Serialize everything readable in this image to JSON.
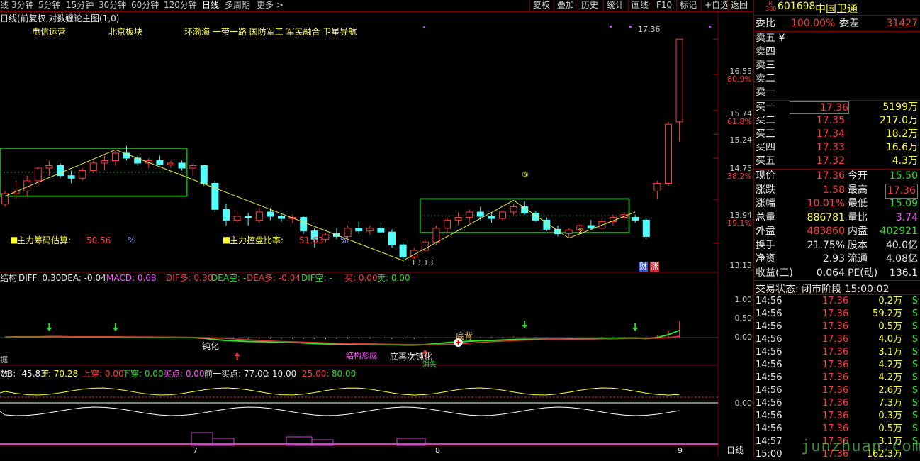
{
  "toolbar": {
    "periods": [
      "线",
      "3分钟",
      "5分钟",
      "15分钟",
      "30分钟",
      "60分钟",
      "120分钟",
      "日线",
      "多周期",
      "更多 >"
    ],
    "buttons": [
      "复权",
      "叠加",
      "历史",
      "统计",
      "画线",
      "F10",
      "标记",
      "+自选",
      "返回"
    ]
  },
  "main_chart": {
    "title": "日线(前复权,对数)",
    "indicator_name": "缠论主图(1,0)",
    "concepts": [
      "电信运营",
      "北京板块",
      "环渤海 一带一路 国防军工 军民融合 卫星导航"
    ],
    "high_label": "17.36",
    "low_label": "13.13",
    "bi_labels": [
      "⑤",
      "②"
    ],
    "estimate_label": "主力筹码估算:",
    "estimate_value": "50.56",
    "estimate_unit": "%",
    "control_label": "主力控盘比率:",
    "control_value": "51.63",
    "control_unit": "%",
    "fin_badge": "财",
    "rise_badge": "涨",
    "axis": [
      {
        "price": "17.36",
        "pct": ""
      },
      {
        "price": "16.55",
        "pct": "80.9%"
      },
      {
        "price": "15.74",
        "pct": "61.8%"
      },
      {
        "price": "15.24",
        "pct": ""
      },
      {
        "price": "14.75",
        "pct": "38.2%"
      },
      {
        "price": "13.94",
        "pct": "19.1%"
      },
      {
        "price": "13.13",
        "pct": ""
      }
    ],
    "candles": [
      [
        13.85,
        14.1,
        13.8,
        14.05
      ],
      [
        14.05,
        14.3,
        13.95,
        14.1
      ],
      [
        14.1,
        14.4,
        14.0,
        14.3
      ],
      [
        14.3,
        14.55,
        14.2,
        14.55
      ],
      [
        14.55,
        14.7,
        14.4,
        14.6
      ],
      [
        14.6,
        14.65,
        14.35,
        14.4
      ],
      [
        14.4,
        14.5,
        14.25,
        14.35
      ],
      [
        14.35,
        14.55,
        14.3,
        14.5
      ],
      [
        14.5,
        14.7,
        14.45,
        14.65
      ],
      [
        14.65,
        14.8,
        14.5,
        14.7
      ],
      [
        14.7,
        14.9,
        14.6,
        14.85
      ],
      [
        14.85,
        15.0,
        14.7,
        14.75
      ],
      [
        14.75,
        14.8,
        14.6,
        14.65
      ],
      [
        14.65,
        14.75,
        14.55,
        14.7
      ],
      [
        14.7,
        14.8,
        14.6,
        14.62
      ],
      [
        14.62,
        14.7,
        14.55,
        14.65
      ],
      [
        14.65,
        14.7,
        14.5,
        14.55
      ],
      [
        14.55,
        14.65,
        14.4,
        14.6
      ],
      [
        14.6,
        14.62,
        14.2,
        14.25
      ],
      [
        14.25,
        14.3,
        13.7,
        13.75
      ],
      [
        13.75,
        13.85,
        13.45,
        13.55
      ],
      [
        13.55,
        13.7,
        13.5,
        13.62
      ],
      [
        13.62,
        13.68,
        13.45,
        13.6
      ],
      [
        13.55,
        13.78,
        13.5,
        13.7
      ],
      [
        13.7,
        13.78,
        13.55,
        13.62
      ],
      [
        13.62,
        13.68,
        13.52,
        13.58
      ],
      [
        13.58,
        13.65,
        13.5,
        13.6
      ],
      [
        13.6,
        13.62,
        13.3,
        13.35
      ],
      [
        13.35,
        13.4,
        13.05,
        13.2
      ],
      [
        13.2,
        13.32,
        13.15,
        13.28
      ],
      [
        13.3,
        13.4,
        13.2,
        13.25
      ],
      [
        13.25,
        13.45,
        13.2,
        13.4
      ],
      [
        13.4,
        13.52,
        13.3,
        13.35
      ],
      [
        13.35,
        13.45,
        13.28,
        13.4
      ],
      [
        13.4,
        13.5,
        13.3,
        13.33
      ],
      [
        13.33,
        13.38,
        13.05,
        13.1
      ],
      [
        13.1,
        13.15,
        12.8,
        12.88
      ],
      [
        12.88,
        13.05,
        12.85,
        13.0
      ],
      [
        13.0,
        13.2,
        12.98,
        13.15
      ],
      [
        13.15,
        13.45,
        13.1,
        13.4
      ],
      [
        13.4,
        13.6,
        13.3,
        13.55
      ],
      [
        13.55,
        13.7,
        13.45,
        13.6
      ],
      [
        13.6,
        13.75,
        13.5,
        13.7
      ],
      [
        13.7,
        13.8,
        13.55,
        13.62
      ],
      [
        13.62,
        13.68,
        13.5,
        13.58
      ],
      [
        13.58,
        13.72,
        13.55,
        13.7
      ],
      [
        13.7,
        13.85,
        13.65,
        13.8
      ],
      [
        13.8,
        13.9,
        13.65,
        13.68
      ],
      [
        13.68,
        13.72,
        13.52,
        13.55
      ],
      [
        13.55,
        13.6,
        13.35,
        13.38
      ],
      [
        13.38,
        13.45,
        13.25,
        13.3
      ],
      [
        13.3,
        13.4,
        13.22,
        13.37
      ],
      [
        13.37,
        13.5,
        13.3,
        13.45
      ],
      [
        13.45,
        13.55,
        13.38,
        13.4
      ],
      [
        13.4,
        13.58,
        13.36,
        13.52
      ],
      [
        13.52,
        13.65,
        13.45,
        13.6
      ],
      [
        13.6,
        13.7,
        13.55,
        13.65
      ],
      [
        13.6,
        13.65,
        13.5,
        13.55
      ],
      [
        13.55,
        13.58,
        13.2,
        13.25
      ],
      [
        14.1,
        14.3,
        13.95,
        14.25
      ],
      [
        14.25,
        15.5,
        14.2,
        15.45
      ],
      [
        15.5,
        17.36,
        15.09,
        17.36
      ]
    ]
  },
  "macd": {
    "name": "结构",
    "diff": "DIFF: 0.30",
    "dea": "DEA: -0.04",
    "macd": "MACD: 0.68",
    "dif_up": "DIF多: 0.30",
    "dea_down": "DEA空: -",
    "dea_up": "DEA多: -0.04",
    "dif_down": "DIF空: -",
    "buy": "买: 0.00",
    "sell": "卖: 0.00",
    "ann_dunhua": "钝化",
    "ann_jiegou": "结构形成",
    "ann_dizai": "底再次钝化",
    "ann_xiaoshi": "消失",
    "ann_dibei": "底背",
    "axis": [
      "1.00",
      "0.50",
      "0.00"
    ]
  },
  "kdj": {
    "name": "数",
    "b": "B: -45.83",
    "f": "F: 70.28",
    "up": "上穿: 0.00",
    "down": "下穿: 0.00",
    "buy": "买点: 0.00",
    "prev_buy_label": "前一买点: 77.00",
    "sep1": ": 10.00",
    "v25": "25.00",
    "v80": ": 80.00",
    "axis": [
      "0.00"
    ]
  },
  "data_label": "据",
  "date_axis": [
    "7",
    "8",
    "9"
  ],
  "period_label": "日线",
  "quote": {
    "code": "601698",
    "name": "中国卫通",
    "badge_top": "R",
    "badge_bottom": "300",
    "weibi_label": "委比",
    "weibi": "100.00%",
    "weicha_label": "委差",
    "weicha": "31427",
    "asks": [
      "卖五 ¥",
      "卖四",
      "卖三",
      "卖二",
      "卖一"
    ],
    "bids": [
      {
        "label": "买一",
        "price": "17.36",
        "vol": "5199万"
      },
      {
        "label": "买二",
        "price": "17.35",
        "vol": "217.0万"
      },
      {
        "label": "买三",
        "price": "17.34",
        "vol": "18.2万"
      },
      {
        "label": "买四",
        "price": "17.33",
        "vol": "16.6万"
      },
      {
        "label": "买五",
        "price": "17.32",
        "vol": "4.3万"
      }
    ],
    "stats": [
      {
        "l1": "现价",
        "v1": "17.36",
        "c1": "red",
        "l2": "今开",
        "v2": "15.50",
        "c2": "green"
      },
      {
        "l1": "涨跌",
        "v1": "1.58",
        "c1": "red",
        "l2": "最高",
        "v2": "17.36",
        "c2": "red"
      },
      {
        "l1": "涨幅",
        "v1": "10.01%",
        "c1": "red",
        "l2": "最低",
        "v2": "15.09",
        "c2": "green"
      },
      {
        "l1": "总量",
        "v1": "886781",
        "c1": "yel",
        "l2": "量比",
        "v2": "3.74",
        "c2": "mag"
      },
      {
        "l1": "外盘",
        "v1": "483860",
        "c1": "red",
        "l2": "内盘",
        "v2": "402921",
        "c2": "green"
      },
      {
        "l1": "换手",
        "v1": "21.75%",
        "c1": "wht",
        "l2": "股本",
        "v2": "40.0亿",
        "c2": "wht"
      },
      {
        "l1": "净资",
        "v1": "2.93",
        "c1": "wht",
        "l2": "流通",
        "v2": "4.08亿",
        "c2": "wht"
      },
      {
        "l1": "收益(三)",
        "v1": "0.064",
        "c1": "wht",
        "l2": "PE(动)",
        "v2": "136.1",
        "c2": "wht"
      }
    ],
    "trade_status": "交易状态: 闭市阶段 15:00:02",
    "ticks": [
      {
        "t": "14:56",
        "p": "17.36",
        "v": "0.2万",
        "s": "S"
      },
      {
        "t": "14:56",
        "p": "17.36",
        "v": "59.2万",
        "s": "S"
      },
      {
        "t": "14:56",
        "p": "17.36",
        "v": "0.5万",
        "s": "S"
      },
      {
        "t": "14:56",
        "p": "17.36",
        "v": "4.0万",
        "s": "S"
      },
      {
        "t": "14:56",
        "p": "17.36",
        "v": "3.1万",
        "s": "S"
      },
      {
        "t": "14:56",
        "p": "17.36",
        "v": "4.2万",
        "s": "S"
      },
      {
        "t": "14:56",
        "p": "17.36",
        "v": "4.2万",
        "s": "S"
      },
      {
        "t": "14:56",
        "p": "17.36",
        "v": "2.6万",
        "s": "S"
      },
      {
        "t": "14:56",
        "p": "17.36",
        "v": "7.3万",
        "s": "S"
      },
      {
        "t": "14:56",
        "p": "17.36",
        "v": "0.3万",
        "s": "S"
      },
      {
        "t": "14:56",
        "p": "17.36",
        "v": "0.5万",
        "s": "S"
      },
      {
        "t": "14:57",
        "p": "17.36",
        "v": "3.1万",
        "s": "S"
      },
      {
        "t": "15:00",
        "p": "17.36",
        "v": "162.3万",
        "s": ""
      }
    ]
  },
  "watermark": "junzhuan.com",
  "colors": {
    "up": "#ff3b3b",
    "down": "#54ffff",
    "box": "#1a9a1a",
    "zig": "#e6e64c",
    "frame": "#7a0000"
  }
}
